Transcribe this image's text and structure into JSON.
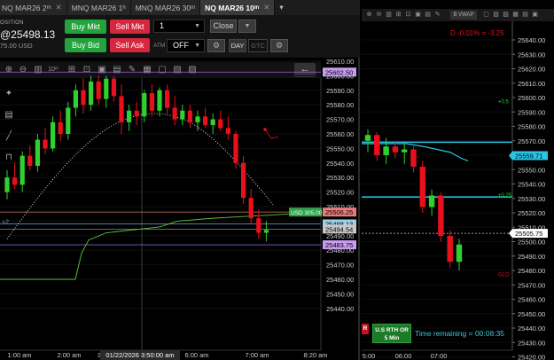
{
  "tabs": [
    {
      "label": "NQ MAR26",
      "tf": "2",
      "unit": "m",
      "active": false,
      "icon": "close-icon"
    },
    {
      "label": "MNQ MAR26",
      "tf": "1",
      "unit": "h",
      "active": false
    },
    {
      "label": "MNQ MAR26",
      "tf": "30",
      "unit": "m",
      "active": false
    },
    {
      "label": "NQ MAR26",
      "tf": "10",
      "unit": "m",
      "active": true
    }
  ],
  "order_panel": {
    "position_label": "OSITION",
    "position_price": "@25498.13",
    "position_usd": "75.00 USD",
    "buy_mkt": "Buy Mkt",
    "sell_mkt": "Sell Mkt",
    "buy_bid": "Buy Bid",
    "sell_ask": "Sell Ask",
    "quantity": "1",
    "close": "Close",
    "atm_label": "ATM",
    "atm_value": "OFF",
    "tif_day": "DAY",
    "tif_gtc": "GTC"
  },
  "colors": {
    "bull": "#2fd02f",
    "bear": "#e8101c",
    "buy_green": "#23a33c",
    "sell_red": "#d7263d",
    "cyan": "#29c6e8",
    "purple": "#b07ce0"
  },
  "left_chart": {
    "y_ticks": [
      "25610.00",
      "25600.00",
      "25590.00",
      "25580.00",
      "25570.00",
      "25560.00",
      "25550.00",
      "25540.00",
      "25530.00",
      "25520.00",
      "25510.00",
      "25500.00",
      "25490.00",
      "25480.00",
      "25470.00",
      "25460.00",
      "25450.00",
      "25440.00"
    ],
    "x_ticks": [
      "1:00 am",
      "2:00 am",
      "3",
      "6:00 am",
      "7:00 am",
      "8:20 am"
    ],
    "crosshair_time": "01/22/2026 3:50:00 am",
    "price_labels": [
      {
        "text": "25602.50",
        "color": "#c89cf0"
      },
      {
        "text": "25506.25",
        "color": "#e87a7a"
      },
      {
        "text": "25498.13",
        "color": "#9ad0e8"
      },
      {
        "text": "25494.54",
        "color": "#c8c8c8"
      },
      {
        "text": "25483.75",
        "color": "#c89cf0"
      }
    ],
    "usd_tag": "USD 305.00",
    "plus_label": "+2",
    "candles": [
      [
        25520,
        25535,
        25515,
        25530
      ],
      [
        25530,
        25540,
        25522,
        25525
      ],
      [
        25525,
        25548,
        25520,
        25545
      ],
      [
        25545,
        25552,
        25535,
        25538
      ],
      [
        25538,
        25560,
        25534,
        25556
      ],
      [
        25556,
        25564,
        25546,
        25550
      ],
      [
        25550,
        25572,
        25548,
        25568
      ],
      [
        25568,
        25576,
        25555,
        25560
      ],
      [
        25560,
        25582,
        25556,
        25578
      ],
      [
        25578,
        25594,
        25572,
        25590
      ],
      [
        25590,
        25598,
        25574,
        25580
      ],
      [
        25580,
        25600,
        25576,
        25596
      ],
      [
        25596,
        25600,
        25580,
        25584
      ],
      [
        25584,
        25600,
        25578,
        25598
      ],
      [
        25598,
        25600,
        25582,
        25586
      ],
      [
        25586,
        25594,
        25560,
        25568
      ],
      [
        25568,
        25580,
        25562,
        25576
      ],
      [
        25576,
        25582,
        25566,
        25572
      ],
      [
        25572,
        25590,
        25568,
        25588
      ],
      [
        25588,
        25594,
        25572,
        25576
      ],
      [
        25576,
        25592,
        25572,
        25590
      ],
      [
        25590,
        25594,
        25574,
        25578
      ],
      [
        25578,
        25586,
        25566,
        25570
      ],
      [
        25570,
        25580,
        25566,
        25576
      ],
      [
        25576,
        25580,
        25564,
        25568
      ],
      [
        25568,
        25576,
        25562,
        25572
      ],
      [
        25572,
        25578,
        25564,
        25566
      ],
      [
        25566,
        25574,
        25560,
        25570
      ],
      [
        25570,
        25576,
        25562,
        25564
      ],
      [
        25564,
        25572,
        25556,
        25560
      ],
      [
        25560,
        25562,
        25536,
        25540
      ],
      [
        25540,
        25545,
        25512,
        25516
      ],
      [
        25516,
        25522,
        25498,
        25502
      ],
      [
        25502,
        25508,
        25488,
        25492
      ],
      [
        25492,
        25500,
        25486,
        25494
      ]
    ]
  },
  "right_chart": {
    "header_stat": "D -0.01% = -3.25",
    "vwap_chip": "B VWAP",
    "y_ticks": [
      "25640.00",
      "25630.00",
      "25620.00",
      "25610.00",
      "25600.00",
      "25590.00",
      "25580.00",
      "25570.00",
      "25560.00",
      "25550.00",
      "25540.00",
      "25530.00",
      "25520.00",
      "25510.00",
      "25500.00",
      "25490.00",
      "25480.00",
      "25470.00",
      "25460.00",
      "25450.00",
      "25440.00",
      "25430.00",
      "25420.00"
    ],
    "x_ticks": [
      "5:00",
      "06:00",
      "07:00"
    ],
    "price_labels": [
      {
        "text": "25559.71",
        "color": "#29c6e8"
      },
      {
        "text": "25505.75",
        "color": "#ffffff"
      }
    ],
    "side_labels": [
      "+0.5",
      "+0.25",
      "GLO"
    ],
    "rth_line1": "U.S RTH OR",
    "rth_line2": "5 Min",
    "r_marker": "R",
    "time_remaining": "Time remaining = 00:08:35",
    "candles": [
      [
        25570,
        25578,
        25562,
        25574
      ],
      [
        25574,
        25576,
        25556,
        25560
      ],
      [
        25560,
        25572,
        25554,
        25566
      ],
      [
        25566,
        25570,
        25558,
        25562
      ],
      [
        25562,
        25568,
        25554,
        25564
      ],
      [
        25564,
        25566,
        25548,
        25552
      ],
      [
        25552,
        25556,
        25520,
        25524
      ],
      [
        25524,
        25536,
        25518,
        25532
      ],
      [
        25532,
        25534,
        25500,
        25504
      ],
      [
        25504,
        25508,
        25482,
        25486
      ],
      [
        25486,
        25502,
        25480,
        25498
      ]
    ]
  }
}
